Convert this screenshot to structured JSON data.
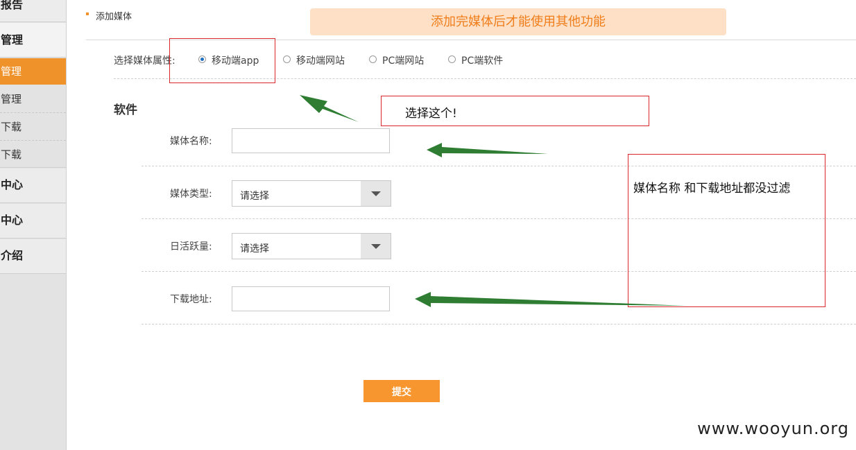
{
  "sidebar": {
    "items": [
      {
        "label": "报告"
      },
      {
        "label": "管理"
      },
      {
        "label": "管理"
      },
      {
        "label": "管理"
      },
      {
        "label": "下载"
      },
      {
        "label": "下载"
      },
      {
        "label": "中心"
      },
      {
        "label": "中心"
      },
      {
        "label": "介绍"
      }
    ]
  },
  "header": {
    "title": "添加媒体",
    "notice": "添加完媒体后才能使用其他功能"
  },
  "media_property": {
    "label": "选择媒体属性:",
    "options": [
      {
        "label": "移动端app",
        "selected": true
      },
      {
        "label": "移动端网站",
        "selected": false
      },
      {
        "label": "PC端网站",
        "selected": false
      },
      {
        "label": "PC端软件",
        "selected": false
      }
    ]
  },
  "form": {
    "section_title": "软件",
    "media_name": {
      "label": "媒体名称:",
      "value": ""
    },
    "media_type": {
      "label": "媒体类型:",
      "selected": "请选择"
    },
    "daily_active": {
      "label": "日活跃量:",
      "selected": "请选择"
    },
    "download_url": {
      "label": "下载地址:",
      "value": ""
    },
    "submit_label": "提交"
  },
  "annotations": {
    "choose_this": "选择这个!",
    "not_filtered": "媒体名称 和下载地址都没过滤"
  },
  "colors": {
    "accent": "#f0922a",
    "notice_bg": "#fde0c5",
    "notice_text": "#f07d1a",
    "annotation_red": "#d8262a",
    "arrow_green": "#2e7d32"
  },
  "watermark": "www.wooyun.org"
}
